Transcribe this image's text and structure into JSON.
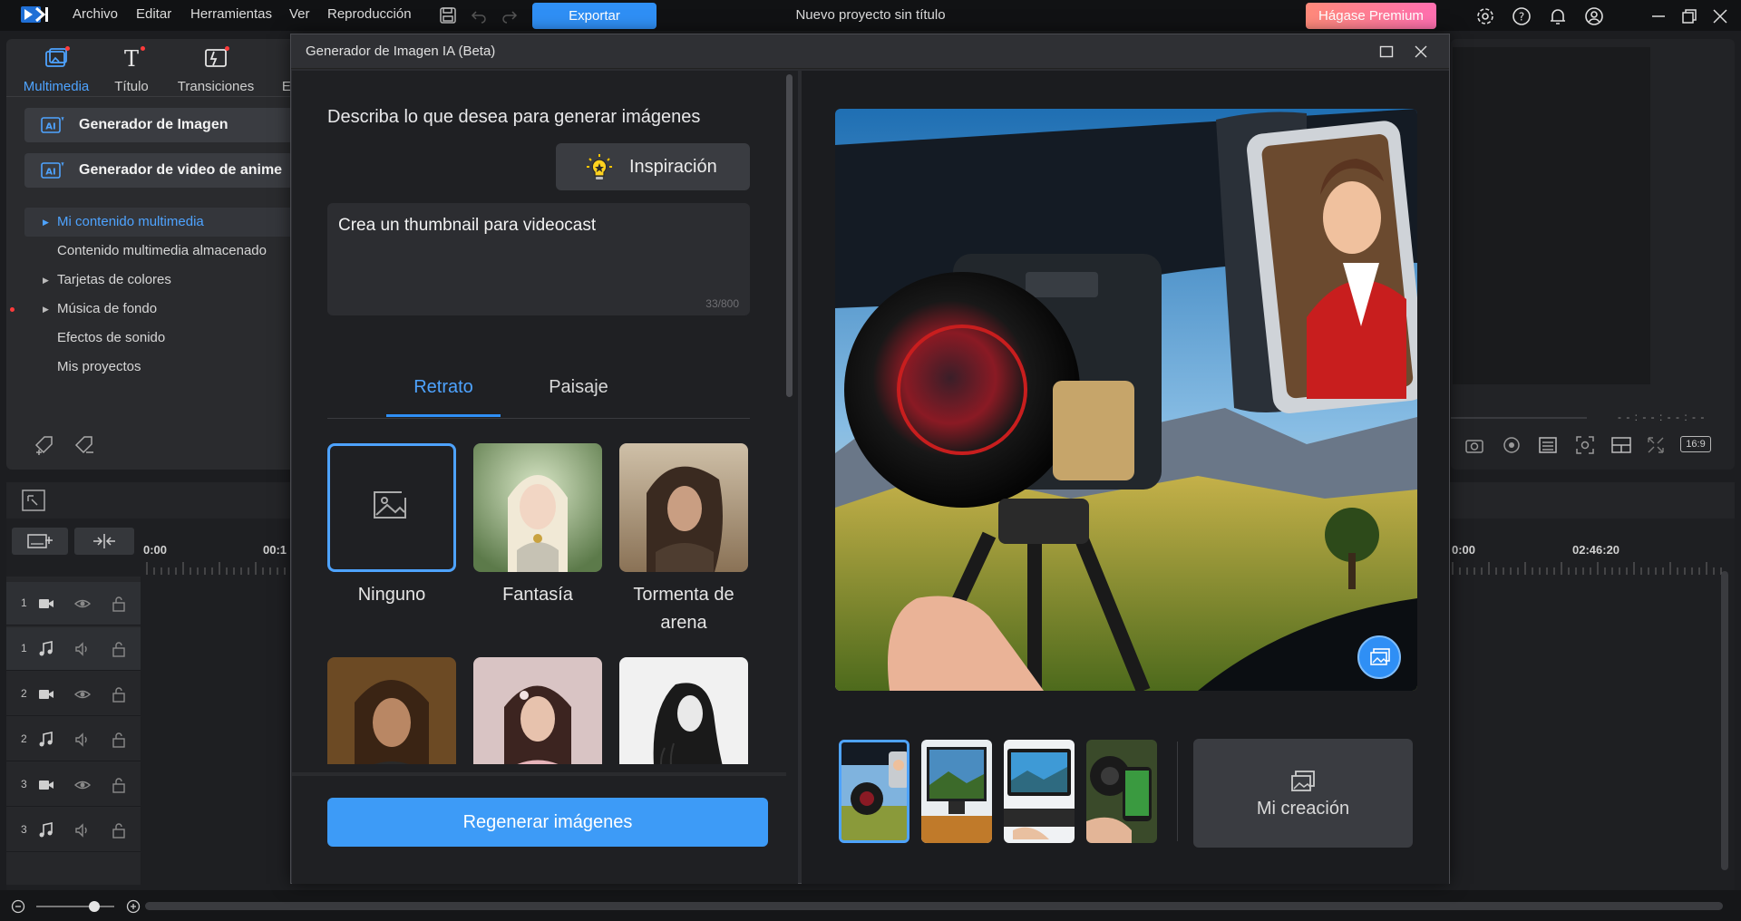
{
  "menubar": {
    "items": [
      "Archivo",
      "Editar",
      "Herramientas",
      "Ver",
      "Reproducción"
    ],
    "export_label": "Exportar",
    "project_title": "Nuevo proyecto sin título",
    "premium_label": "Hágase Premium"
  },
  "library": {
    "tabs": [
      {
        "label": "Multimedia",
        "icon": "media-icon",
        "active": true
      },
      {
        "label": "Título",
        "icon": "title-icon",
        "active": false
      },
      {
        "label": "Transiciones",
        "icon": "transitions-icon",
        "active": false
      },
      {
        "label": "Ef",
        "icon": "effects-icon",
        "active": false
      }
    ],
    "generators": [
      {
        "label": "Generador de Imagen",
        "icon": "ai-icon"
      },
      {
        "label": "Generador de video de anime",
        "icon": "ai-icon"
      }
    ],
    "tree": [
      {
        "label": "Mi contenido multimedia",
        "expandable": true,
        "selected": true
      },
      {
        "label": "Contenido multimedia almacenado",
        "expandable": false,
        "selected": false
      },
      {
        "label": "Tarjetas de colores",
        "expandable": true,
        "selected": false
      },
      {
        "label": "Música de fondo",
        "expandable": true,
        "selected": false
      },
      {
        "label": "Efectos de sonido",
        "expandable": false,
        "selected": false
      },
      {
        "label": "Mis proyectos",
        "expandable": false,
        "selected": false
      }
    ]
  },
  "preview": {
    "time": "- - : - - : - - : - -",
    "ratio": "16:9"
  },
  "timeline": {
    "ruler_left": [
      "0:00",
      "00:1"
    ],
    "ruler_right": [
      "0:00",
      "02:46:20"
    ],
    "tracks": [
      {
        "num": "1",
        "type": "video",
        "selected": true
      },
      {
        "num": "1",
        "type": "audio",
        "selected": true
      },
      {
        "num": "2",
        "type": "video",
        "selected": false
      },
      {
        "num": "2",
        "type": "audio",
        "selected": false
      },
      {
        "num": "3",
        "type": "video",
        "selected": false
      },
      {
        "num": "3",
        "type": "audio",
        "selected": false
      }
    ]
  },
  "dialog": {
    "title": "Generador de Imagen IA (Beta)",
    "prompt_heading": "Describa lo que desea para generar imágenes",
    "inspiration_label": "Inspiración",
    "prompt_text": "Crea un thumbnail para videocast",
    "char_count": "33/800",
    "style_tabs": [
      {
        "label": "Retrato",
        "active": true
      },
      {
        "label": "Paisaje",
        "active": false
      }
    ],
    "styles": [
      {
        "label": "Ninguno",
        "active": true
      },
      {
        "label": "Fantasía",
        "active": false
      },
      {
        "label": "Tormenta de arena",
        "active": false
      },
      {
        "label": "",
        "active": false
      },
      {
        "label": "",
        "active": false
      },
      {
        "label": "",
        "active": false
      }
    ],
    "regen_label": "Regenerar imágenes",
    "my_creation_label": "Mi creación"
  }
}
